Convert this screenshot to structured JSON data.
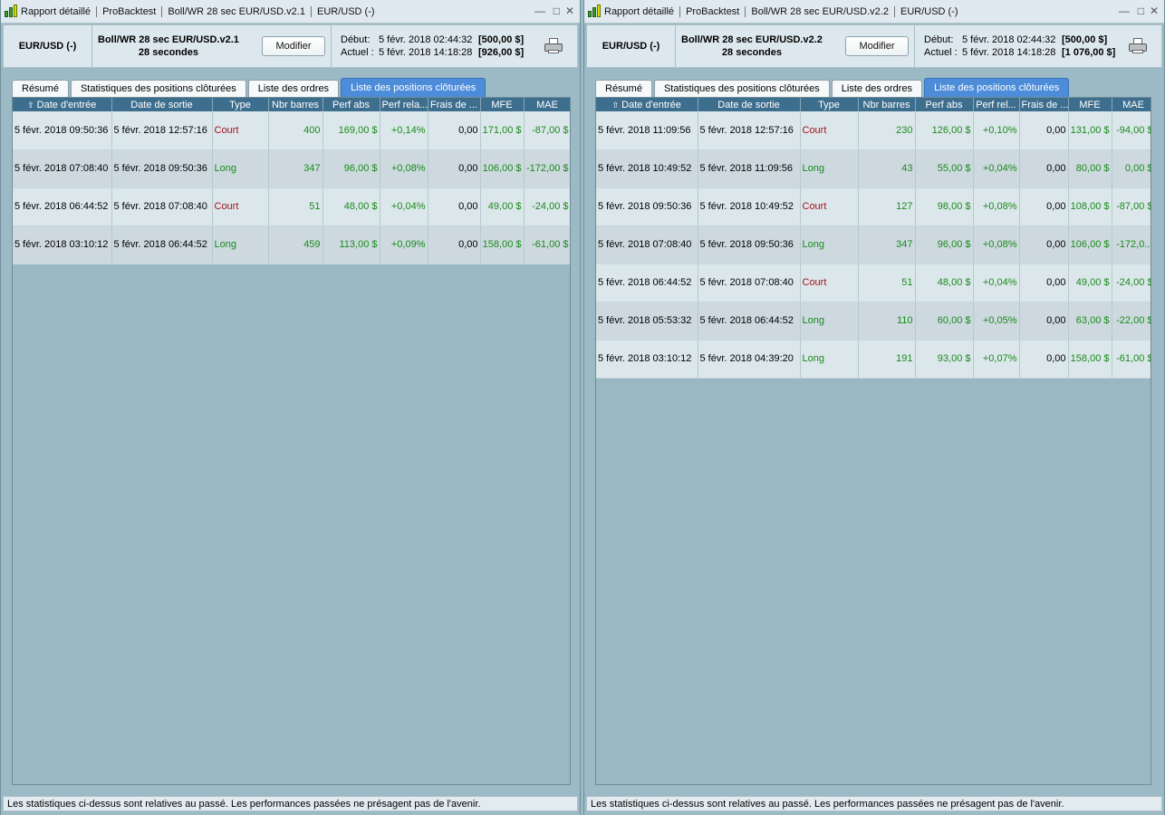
{
  "windows": [
    {
      "title": {
        "report": "Rapport détaillé",
        "app": "ProBacktest",
        "strategy": "Boll/WR 28 sec EUR/USD.v2.1",
        "symbol": "EUR/USD (-)"
      },
      "header": {
        "symbol": "EUR/USD (-)",
        "strategy": "Boll/WR 28 sec EUR/USD.v2.1",
        "timeframe": "28 secondes",
        "modify_label": "Modifier",
        "start_label": "Début:",
        "start_date": "5 févr. 2018 02:44:32",
        "start_amount": "[500,00 $]",
        "current_label": "Actuel :",
        "current_date": "5 févr. 2018 14:18:28",
        "current_amount": "[926,00 $]"
      },
      "tabs": [
        "Résumé",
        "Statistiques des positions clôturées",
        "Liste des ordres",
        "Liste des positions clôturées"
      ],
      "active_tab": 3,
      "columns": [
        "Date d'entrée",
        "Date de sortie",
        "Type",
        "Nbr barres",
        "Perf abs",
        "Perf rela...",
        "Frais de ...",
        "MFE",
        "MAE"
      ],
      "rows": [
        {
          "entry": "5 févr. 2018 09:50:36",
          "exit": "5 févr. 2018 12:57:16",
          "type": "Court",
          "bars": "400",
          "perf_abs": "169,00 $",
          "perf_rel": "+0,14%",
          "fees": "0,00",
          "mfe": "171,00 $",
          "mae": "-87,00 $"
        },
        {
          "entry": "5 févr. 2018 07:08:40",
          "exit": "5 févr. 2018 09:50:36",
          "type": "Long",
          "bars": "347",
          "perf_abs": "96,00 $",
          "perf_rel": "+0,08%",
          "fees": "0,00",
          "mfe": "106,00 $",
          "mae": "-172,00 $"
        },
        {
          "entry": "5 févr. 2018 06:44:52",
          "exit": "5 févr. 2018 07:08:40",
          "type": "Court",
          "bars": "51",
          "perf_abs": "48,00 $",
          "perf_rel": "+0,04%",
          "fees": "0,00",
          "mfe": "49,00 $",
          "mae": "-24,00 $"
        },
        {
          "entry": "5 févr. 2018 03:10:12",
          "exit": "5 févr. 2018 06:44:52",
          "type": "Long",
          "bars": "459",
          "perf_abs": "113,00 $",
          "perf_rel": "+0,09%",
          "fees": "0,00",
          "mfe": "158,00 $",
          "mae": "-61,00 $"
        }
      ],
      "footer": "Les statistiques ci-dessus sont relatives au passé. Les performances passées ne présagent pas de l'avenir."
    },
    {
      "title": {
        "report": "Rapport détaillé",
        "app": "ProBacktest",
        "strategy": "Boll/WR 28 sec EUR/USD.v2.2",
        "symbol": "EUR/USD (-)"
      },
      "header": {
        "symbol": "EUR/USD (-)",
        "strategy": "Boll/WR 28 sec EUR/USD.v2.2",
        "timeframe": "28 secondes",
        "modify_label": "Modifier",
        "start_label": "Début:",
        "start_date": "5 févr. 2018 02:44:32",
        "start_amount": "[500,00 $]",
        "current_label": "Actuel :",
        "current_date": "5 févr. 2018 14:18:28",
        "current_amount": "[1 076,00 $]"
      },
      "tabs": [
        "Résumé",
        "Statistiques des positions clôturées",
        "Liste des ordres",
        "Liste des positions clôturées"
      ],
      "active_tab": 3,
      "columns": [
        "Date d'entrée",
        "Date de sortie",
        "Type",
        "Nbr barres",
        "Perf abs",
        "Perf rel...",
        "Frais de ...",
        "MFE",
        "MAE"
      ],
      "rows": [
        {
          "entry": "5 févr. 2018 11:09:56",
          "exit": "5 févr. 2018 12:57:16",
          "type": "Court",
          "bars": "230",
          "perf_abs": "126,00 $",
          "perf_rel": "+0,10%",
          "fees": "0,00",
          "mfe": "131,00 $",
          "mae": "-94,00 $"
        },
        {
          "entry": "5 févr. 2018 10:49:52",
          "exit": "5 févr. 2018 11:09:56",
          "type": "Long",
          "bars": "43",
          "perf_abs": "55,00 $",
          "perf_rel": "+0,04%",
          "fees": "0,00",
          "mfe": "80,00 $",
          "mae": "0,00 $"
        },
        {
          "entry": "5 févr. 2018 09:50:36",
          "exit": "5 févr. 2018 10:49:52",
          "type": "Court",
          "bars": "127",
          "perf_abs": "98,00 $",
          "perf_rel": "+0,08%",
          "fees": "0,00",
          "mfe": "108,00 $",
          "mae": "-87,00 $"
        },
        {
          "entry": "5 févr. 2018 07:08:40",
          "exit": "5 févr. 2018 09:50:36",
          "type": "Long",
          "bars": "347",
          "perf_abs": "96,00 $",
          "perf_rel": "+0,08%",
          "fees": "0,00",
          "mfe": "106,00 $",
          "mae": "-172,0..."
        },
        {
          "entry": "5 févr. 2018 06:44:52",
          "exit": "5 févr. 2018 07:08:40",
          "type": "Court",
          "bars": "51",
          "perf_abs": "48,00 $",
          "perf_rel": "+0,04%",
          "fees": "0,00",
          "mfe": "49,00 $",
          "mae": "-24,00 $"
        },
        {
          "entry": "5 févr. 2018 05:53:32",
          "exit": "5 févr. 2018 06:44:52",
          "type": "Long",
          "bars": "110",
          "perf_abs": "60,00 $",
          "perf_rel": "+0,05%",
          "fees": "0,00",
          "mfe": "63,00 $",
          "mae": "-22,00 $"
        },
        {
          "entry": "5 févr. 2018 03:10:12",
          "exit": "5 févr. 2018 04:39:20",
          "type": "Long",
          "bars": "191",
          "perf_abs": "93,00 $",
          "perf_rel": "+0,07%",
          "fees": "0,00",
          "mfe": "158,00 $",
          "mae": "-61,00 $"
        }
      ],
      "footer": "Les statistiques ci-dessus sont relatives au passé. Les performances passées ne présagent pas de l'avenir."
    }
  ],
  "colors": {
    "positive": "#1b8a1b",
    "short": "#a3141c",
    "active_tab": "#4d8cd9",
    "table_header": "#3e6e8e"
  }
}
